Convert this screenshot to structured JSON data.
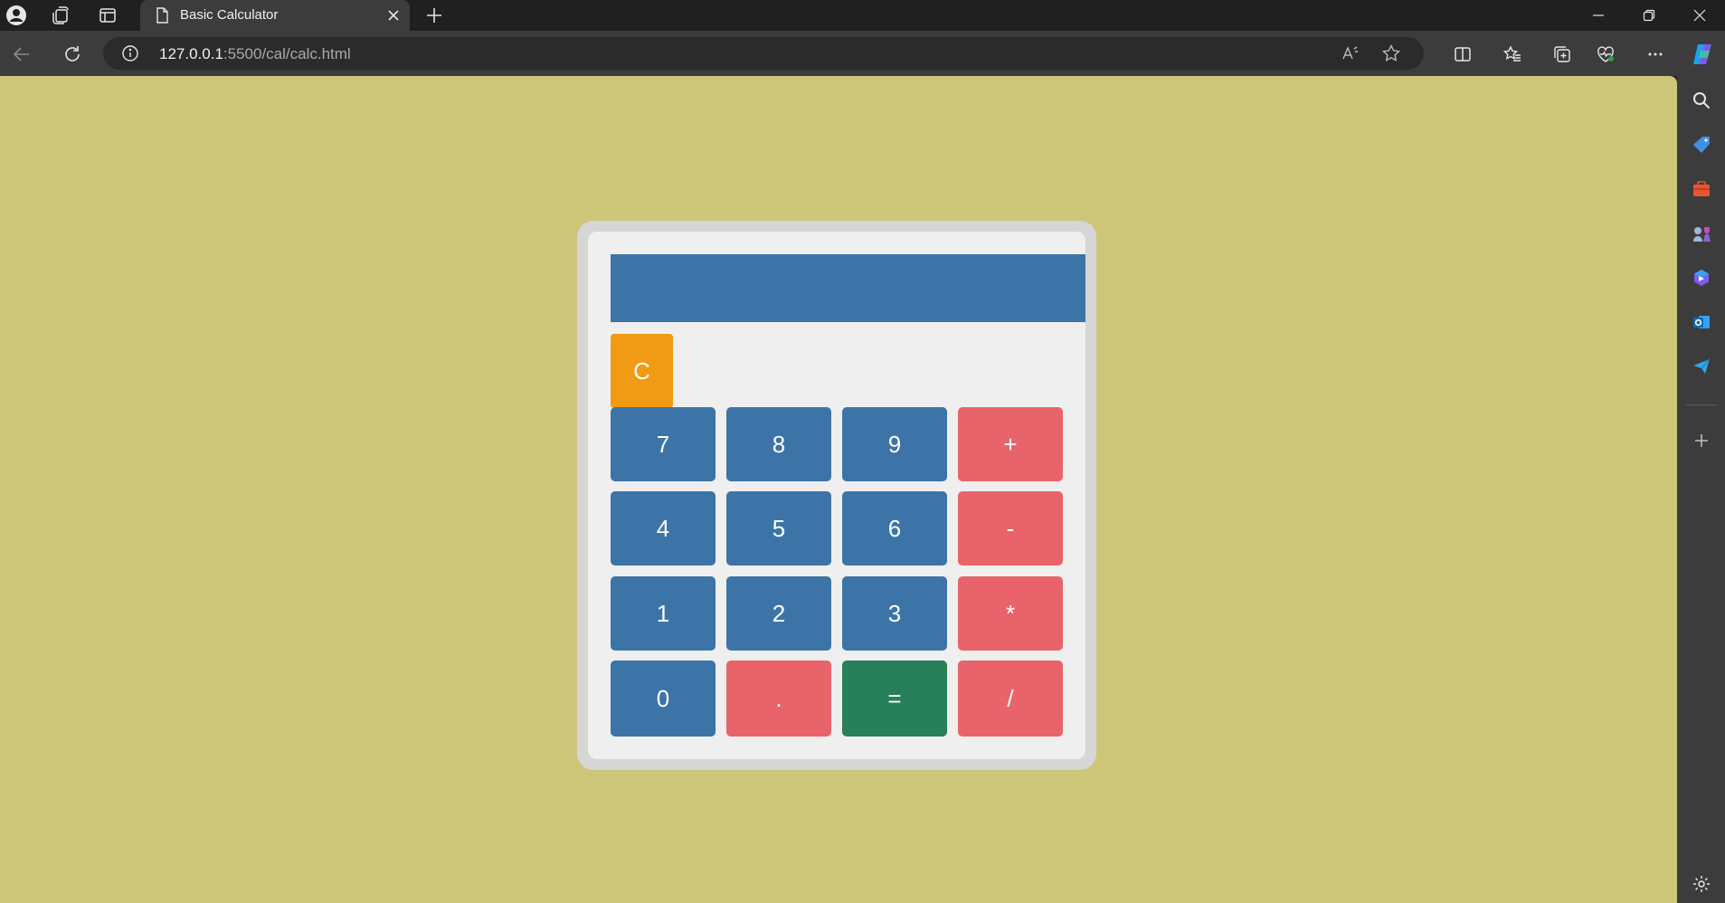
{
  "browser": {
    "tab_title": "Basic Calculator",
    "url_host": "127.0.0.1",
    "url_rest": ":5500/cal/calc.html"
  },
  "calculator": {
    "display_value": "",
    "clear_label": "C",
    "keys": {
      "seven": "7",
      "eight": "8",
      "nine": "9",
      "plus": "+",
      "four": "4",
      "five": "5",
      "six": "6",
      "minus": "-",
      "one": "1",
      "two": "2",
      "three": "3",
      "multiply": "*",
      "zero": "0",
      "dot": ".",
      "equals": "=",
      "divide": "/"
    }
  },
  "colors": {
    "page_background": "#cdc679",
    "display": "#3c74a8",
    "number_key": "#3c74a8",
    "operator_key": "#e8646a",
    "equals_key": "#27805a",
    "clear_key": "#f19a13"
  }
}
